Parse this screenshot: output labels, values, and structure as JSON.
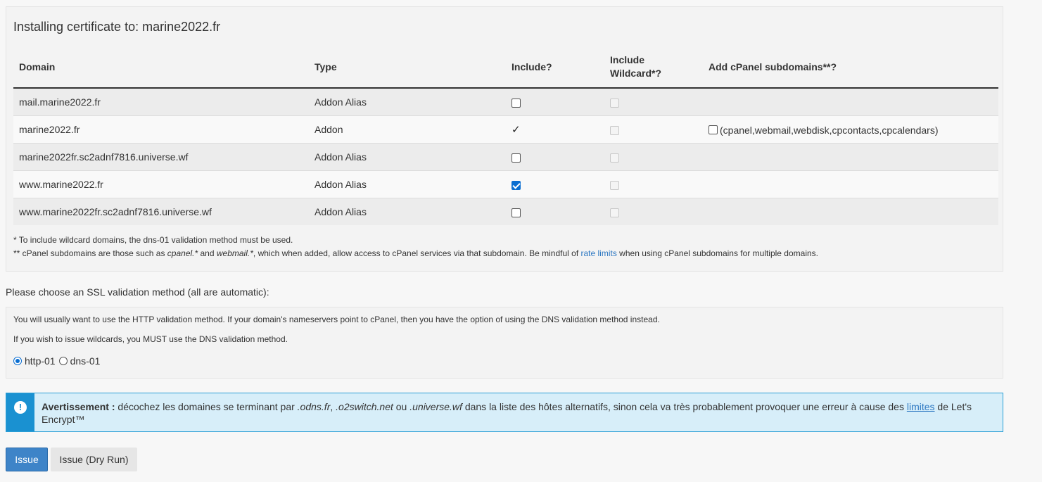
{
  "panel": {
    "title": "Installing certificate to: marine2022.fr",
    "columns": {
      "domain": "Domain",
      "type": "Type",
      "include": "Include?",
      "include_wildcard": "Include Wildcard*?",
      "add_subdomains": "Add cPanel subdomains**?"
    },
    "rows": [
      {
        "domain": "mail.marine2022.fr",
        "type": "Addon Alias",
        "include": "unchecked"
      },
      {
        "domain": "marine2022.fr",
        "type": "Addon",
        "include": "checkmark",
        "subdomains_label": "(cpanel,webmail,webdisk,cpcontacts,cpcalendars)",
        "check_glyph": "✓"
      },
      {
        "domain": "marine2022fr.sc2adnf7816.universe.wf",
        "type": "Addon Alias",
        "include": "unchecked"
      },
      {
        "domain": "www.marine2022.fr",
        "type": "Addon Alias",
        "include": "checked"
      },
      {
        "domain": "www.marine2022fr.sc2adnf7816.universe.wf",
        "type": "Addon Alias",
        "include": "unchecked"
      }
    ],
    "notes": {
      "wildcard_note": "* To include wildcard domains, the dns-01 validation method must be used.",
      "subdomain_prefix": "** cPanel subdomains are those such as ",
      "subdomain_em1": "cpanel.*",
      "subdomain_and": " and ",
      "subdomain_em2": "webmail.*",
      "subdomain_mid": ", which when added, allow access to cPanel services via that subdomain. Be mindful of ",
      "rate_limits_link": "rate limits",
      "subdomain_suffix": " when using cPanel subdomains for multiple domains."
    }
  },
  "validation": {
    "heading": "Please choose an SSL validation method (all are automatic):",
    "line1": "You will usually want to use the HTTP validation method. If your domain's nameservers point to cPanel, then you have the option of using the DNS validation method instead.",
    "line2": "If you wish to issue wildcards, you MUST use the DNS validation method.",
    "options": [
      {
        "label": "http-01",
        "selected": true
      },
      {
        "label": "dns-01",
        "selected": false
      }
    ]
  },
  "alert": {
    "icon": "exclamation-icon",
    "bold": "Avertissement :",
    "t1": " décochez les domaines se terminant par ",
    "e1": ".odns.fr",
    "t2": ", ",
    "e2": ".o2switch.net",
    "t3": " ou ",
    "e3": ".universe.wf",
    "t4": " dans la liste des hôtes alternatifs, sinon cela va très probablement provoquer une erreur à cause des ",
    "link": "limites",
    "t5": " de Let's Encrypt™"
  },
  "buttons": {
    "issue": "Issue",
    "dry_run": "Issue (Dry Run)"
  },
  "colors": {
    "primary": "#3e84c8",
    "alert_bg": "#d7eef9",
    "alert_accent": "#1a91d1",
    "link": "#2d78c2"
  }
}
